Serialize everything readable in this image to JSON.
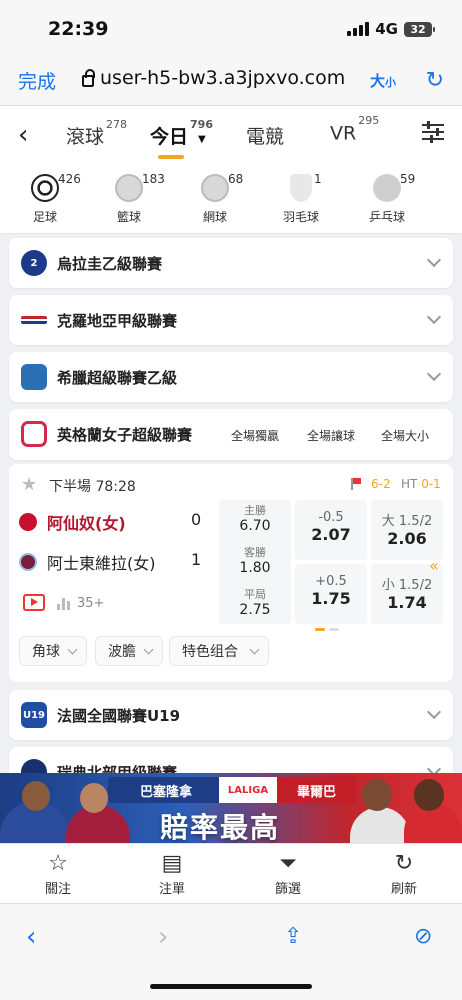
{
  "status_bar": {
    "time": "22:39",
    "network": "4G",
    "battery": "32"
  },
  "browser": {
    "done_label": "完成",
    "url": "user-h5-bw3.a3jpxvo.com",
    "text_size_label": "大",
    "text_size_small": "小"
  },
  "nav": {
    "tabs": [
      {
        "label": "滾球",
        "count": "278"
      },
      {
        "label": "今日",
        "count": "796"
      },
      {
        "label": "電競",
        "count": ""
      },
      {
        "label": "VR",
        "count": "295"
      }
    ],
    "active_tab": "今日"
  },
  "sports": [
    {
      "name": "足球",
      "count": "426",
      "icon": "soccer-ball-icon"
    },
    {
      "name": "籃球",
      "count": "183",
      "icon": "basketball-icon"
    },
    {
      "name": "網球",
      "count": "68",
      "icon": "tennis-ball-icon"
    },
    {
      "name": "羽毛球",
      "count": "1",
      "icon": "shuttlecock-icon"
    },
    {
      "name": "乒乓球",
      "count": "59",
      "icon": "ping-pong-icon"
    }
  ],
  "leagues": [
    {
      "name": "烏拉圭乙級聯賽",
      "logo": "uruguay-league-logo",
      "color": "#1b3a8a"
    },
    {
      "name": "克羅地亞甲級聯賽",
      "logo": "croatia-league-logo",
      "color": "#c0262d"
    },
    {
      "name": "希臘超級聯賽乙級",
      "logo": "greece-league-logo",
      "color": "#2a6fb6"
    }
  ],
  "expanded_league": {
    "name": "英格蘭女子超級聯賽",
    "markets": [
      "全場獨贏",
      "全場讓球",
      "全場大小"
    ],
    "accent": "#d6284b"
  },
  "match": {
    "period": "下半場",
    "clock": "78:28",
    "corners": "6-2",
    "ht_label": "HT",
    "ht_score": "0-1",
    "home": {
      "name": "阿仙奴(女)",
      "score": "0",
      "color": "#c8102e"
    },
    "away": {
      "name": "阿士東維拉(女)",
      "score": "1",
      "color": "#7a1e3d"
    },
    "more_count": "35+",
    "moneyline": [
      {
        "label": "主勝",
        "odds": "6.70"
      },
      {
        "label": "客勝",
        "odds": "1.80"
      },
      {
        "label": "平局",
        "odds": "2.75"
      }
    ],
    "handicap": [
      {
        "line": "-0.5",
        "odds": "2.07"
      },
      {
        "line": "+0.5",
        "odds": "1.75"
      }
    ],
    "totals": [
      {
        "line": "大 1.5/2",
        "odds": "2.06"
      },
      {
        "line": "小 1.5/2",
        "odds": "1.74"
      }
    ],
    "filters": [
      "角球",
      "波膽",
      "特色组合"
    ]
  },
  "more_leagues": [
    {
      "name": "法國全國聯賽U19",
      "logo": "U19",
      "color": "#1f4fa3"
    },
    {
      "name": "瑞典北部甲級聯賽",
      "logo": "sweden-league-logo",
      "color": "#1a2f6e"
    }
  ],
  "banner": {
    "team_left": "巴塞隆拿",
    "league": "LALIGA",
    "team_right": "畢爾巴",
    "slogan": "賠率最高"
  },
  "bottom_tabs": [
    {
      "label": "關注",
      "icon": "star-icon"
    },
    {
      "label": "注單",
      "icon": "clipboard-icon"
    },
    {
      "label": "篩選",
      "icon": "funnel-icon"
    },
    {
      "label": "刷新",
      "icon": "refresh-icon"
    }
  ]
}
